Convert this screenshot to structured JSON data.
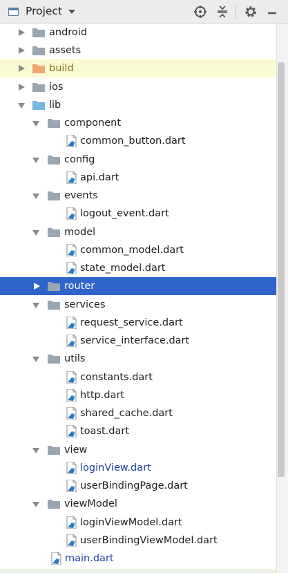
{
  "header": {
    "title": "Project"
  },
  "colors": {
    "selection": "#2f65ca",
    "folder": "#9aa6b2",
    "lib_folder": "#75b6e3",
    "build_folder": "#f0a66e",
    "highlight": "#fafad2"
  },
  "tree": {
    "android": "android",
    "assets": "assets",
    "build": "build",
    "ios": "ios",
    "lib": "lib",
    "component": "component",
    "common_button": "common_button.dart",
    "config": "config",
    "api": "api.dart",
    "events": "events",
    "logout_event": "logout_event.dart",
    "model": "model",
    "common_model": "common_model.dart",
    "state_model": "state_model.dart",
    "router": "router",
    "services": "services",
    "request_service": "request_service.dart",
    "service_interface": "service_interface.dart",
    "utils": "utils",
    "constants": "constants.dart",
    "http": "http.dart",
    "shared_cache": "shared_cache.dart",
    "toast": "toast.dart",
    "view": "view",
    "loginView": "loginView.dart",
    "userBindingPage": "userBindingPage.dart",
    "viewModel": "viewModel",
    "loginViewModel": "loginViewModel.dart",
    "userBindingViewModel": "userBindingViewModel.dart",
    "main": "main.dart"
  }
}
